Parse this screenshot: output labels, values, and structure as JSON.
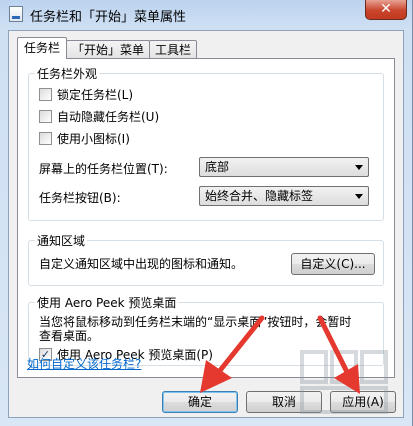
{
  "window": {
    "title": "任务栏和「开始」菜单属性",
    "close_label": "✕"
  },
  "tabs": [
    {
      "label": "任务栏",
      "active": true
    },
    {
      "label": "「开始」菜单",
      "active": false
    },
    {
      "label": "工具栏",
      "active": false
    }
  ],
  "appearance": {
    "title": "任务栏外观",
    "lock": {
      "label": "锁定任务栏(L)",
      "checked": false
    },
    "autohide": {
      "label": "自动隐藏任务栏(U)",
      "checked": false
    },
    "small_icons": {
      "label": "使用小图标(I)",
      "checked": false
    },
    "location_label": "屏幕上的任务栏位置(T):",
    "location_value": "底部",
    "buttons_label": "任务栏按钮(B):",
    "buttons_value": "始终合并、隐藏标签"
  },
  "notification": {
    "title": "通知区域",
    "description": "自定义通知区域中出现的图标和通知。",
    "customize_label": "自定义(C)..."
  },
  "aero_peek": {
    "title": "使用 Aero Peek 预览桌面",
    "description_line1": "当您将鼠标移动到任务栏末端的“显示桌面”按钮时，会暂时",
    "description_line2": "查看桌面。",
    "checkbox": {
      "label": "使用 Aero Peek 预览桌面(P)",
      "checked": true
    }
  },
  "help_link": "如何自定义该任务栏?",
  "footer": {
    "ok_label": "确定",
    "cancel_label": "取消",
    "apply_label": "应用(A)"
  },
  "colors": {
    "annotation_arrow": "#e5392f",
    "link": "#0066cc"
  }
}
